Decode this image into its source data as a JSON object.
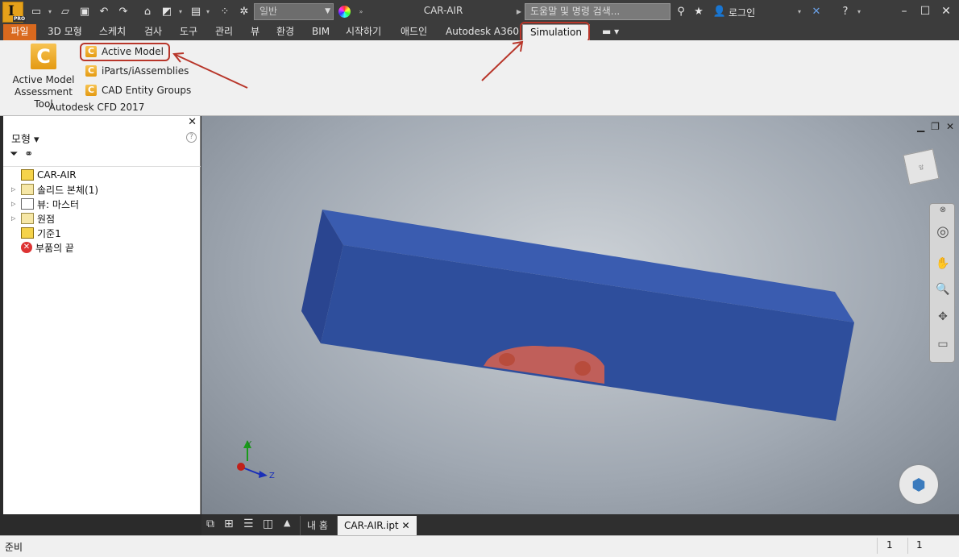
{
  "window": {
    "title": "CAR-AIR",
    "app_logo": "Inventor PRO",
    "style_select": "일반",
    "search_placeholder": "도움말 및 명령 검색...",
    "login_label": "로그인"
  },
  "ribbon_tabs": {
    "file": "파일",
    "model3d": "3D 모형",
    "sketch": "스케치",
    "inspect": "검사",
    "tools": "도구",
    "manage": "관리",
    "view": "뷰",
    "environments": "환경",
    "bim": "BIM",
    "get_started": "시작하기",
    "addins": "애드인",
    "a360": "Autodesk A360",
    "simulation": "Simulation"
  },
  "ribbon": {
    "big_tool_line1": "Active Model",
    "big_tool_line2": "Assessment Tool",
    "active_model": "Active Model",
    "iparts": "iParts/iAssemblies",
    "cad_groups": "CAD Entity Groups",
    "panel_title": "Autodesk CFD 2017"
  },
  "browser": {
    "title": "모형",
    "tree": [
      {
        "label": "CAR-AIR"
      },
      {
        "label": "솔리드 본체(1)"
      },
      {
        "label": "뷰: 마스터"
      },
      {
        "label": "원점"
      },
      {
        "label": "기준1"
      },
      {
        "label": "부품의 끝"
      }
    ]
  },
  "viewport": {
    "axis_y": "Y",
    "axis_z": "Z",
    "box_color": "#2e4e9c",
    "car_color": "#d9634f"
  },
  "doc_tabs": {
    "home": "내 홈",
    "document": "CAR-AIR.ipt"
  },
  "status": {
    "text": "준비",
    "value1": "1",
    "value2": "1"
  }
}
